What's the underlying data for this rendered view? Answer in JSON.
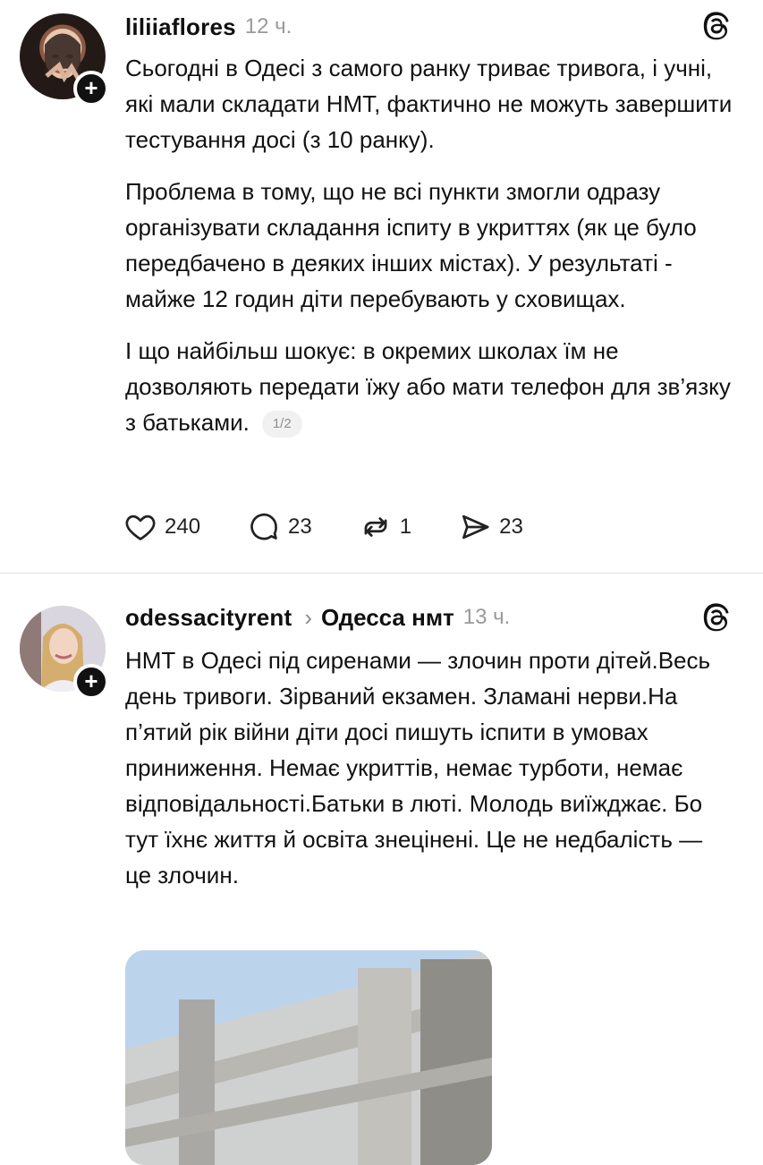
{
  "posts": [
    {
      "username": "liliiaflores",
      "time": "12 ч.",
      "paragraphs": [
        "Сьогодні в Одесі з самого ранку триває тривога, і учні, які мали складати НМТ, фактично не можуть завершити тестування досі (з 10 ранку).",
        "Проблема в тому, що не всі пункти змогли одразу організувати складання іспиту в укриттях (як це було передбачено в деяких інших містах). У результаті - майже 12 годин діти перебувають у сховищах.",
        "І що найбільш шокує: в окремих школах їм не дозволяють передати їжу або мати телефон для зв’язку з батьками."
      ],
      "page_indicator": "1/2",
      "likes": "240",
      "comments": "23",
      "reposts": "1",
      "shares": "23"
    },
    {
      "username": "odessacityrent",
      "topic": "Одесса нмт",
      "time": "13 ч.",
      "paragraphs": [
        "НМТ в Одесі  під сиренами — злочин проти дітей.Весь день тривоги. Зірваний екзамен. Зламані нерви.На п’ятий рік війни діти досі пишуть іспити в умовах приниження. Немає укриттів, немає турботи, немає відповідальності.Батьки в люті. Молодь виїжджає. Бо тут їхнє життя й освіта знецінені. Це не недбалість — це злочин."
      ]
    }
  ],
  "icons": {
    "follow": "+",
    "chevron": "›"
  }
}
